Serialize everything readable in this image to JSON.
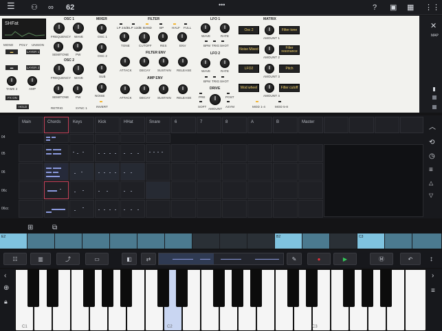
{
  "topbar": {
    "counter": "62",
    "icons": [
      "menu-icon",
      "link-icon",
      "loop-icon",
      "help-icon",
      "record-window-icon",
      "grid-icon",
      "more-icon"
    ]
  },
  "synth": {
    "preset_name": "SHFat",
    "sections": {
      "osc1": "OSC 1",
      "osc2": "OSC 2",
      "mixer": "MIXER",
      "filter": "FILTER",
      "filter_env": "FILTER ENV",
      "amp_env": "AMP ENV",
      "lfo1": "LFO 1",
      "lfo2": "LFO 2",
      "drive": "DRIVE",
      "matrix": "MATRIX"
    },
    "left_labels": [
      "MONO",
      "POLY",
      "UNISON",
      "LAYER 1",
      "LAYER 2",
      "TAME 2",
      "AMP",
      "HOLD"
    ],
    "osc1_labels": [
      "FREQUENCY",
      "WAVE",
      "SEMITONE",
      "PW"
    ],
    "osc2_labels": [
      "FREQUENCY",
      "WAVE",
      "SEMITONE",
      "PW",
      "RETRIG",
      "SYNC 1"
    ],
    "mixer_labels": [
      "OSC 1",
      "OSC 2",
      "SUB",
      "NOISE",
      "INVERT"
    ],
    "filter_labels": [
      "LP 24dB",
      "LP 12dB",
      "BAND",
      "BP",
      "HALF",
      "FULL",
      "TONE",
      "CUTOFF",
      "RES",
      "ENV"
    ],
    "filter_env_labels": [
      "ATTACK",
      "DECAY",
      "SUSTAIN",
      "RELEASE"
    ],
    "amp_env_labels": [
      "ATTACK",
      "DECAY",
      "SUSTAIN",
      "RELEASE"
    ],
    "lfo1_labels": [
      "WAVE",
      "RATE",
      "BPM",
      "TRIG",
      "SHOT"
    ],
    "lfo2_labels": [
      "WAVE",
      "RATE",
      "BPM",
      "TRIG",
      "SHOT"
    ],
    "drive_labels": [
      "PRE",
      "POST",
      "SOFT",
      "AMOUNT",
      "ASYM"
    ],
    "matrix_sources": [
      "Osc 2",
      "Noise Mixed",
      "LFO2",
      "Mod wheel"
    ],
    "matrix_targets": [
      "Filter tone",
      "Filter resonance",
      "Pitch",
      "Filter cutoff"
    ],
    "matrix_amounts": [
      "AMOUNT 1",
      "AMOUNT 2",
      "AMOUNT 3",
      "AMOUNT 4"
    ],
    "matrix_footer": [
      "MOD 1-4",
      "MOD 5-8"
    ],
    "map_label": "MAP"
  },
  "grid": {
    "columns": [
      "Main",
      "Chords",
      "Keys",
      "Kick",
      "HHat",
      "Snare",
      "6",
      "7",
      "8",
      "A",
      "B",
      "Master"
    ],
    "rows": [
      "04",
      "05",
      "06",
      "06c",
      "06cc"
    ]
  },
  "scenes": [
    "E2",
    "",
    "",
    "",
    "",
    "",
    "",
    "",
    "",
    "",
    "B2",
    "",
    "",
    "C3",
    "",
    ""
  ],
  "keyboard": {
    "octave_labels": [
      "C1",
      "C2",
      "C3"
    ]
  },
  "colors": {
    "accent_red": "#c8435a",
    "scene_teal": "#4b7a8f",
    "scene_highlight": "#7fc3df",
    "note_blue": "#8c9be0",
    "matrix_text": "#f4d36a",
    "record": "#e0323a",
    "play": "#34c759"
  }
}
